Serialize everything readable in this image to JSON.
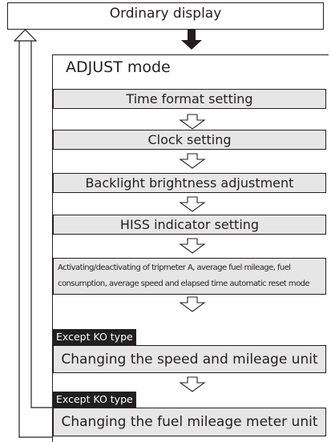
{
  "top": {
    "label": "Ordinary display"
  },
  "panel": {
    "title": "ADJUST mode"
  },
  "steps": [
    {
      "label": "Time format setting"
    },
    {
      "label": "Clock setting"
    },
    {
      "label": "Backlight brightness adjustment"
    },
    {
      "label": "HISS indicator setting"
    },
    {
      "label": "Activating/deactivating of tripmeter A, average fuel mileage, fuel consumption, average speed and elapsed time automatic reset mode"
    },
    {
      "tag": "Except KO type",
      "label": "Changing the speed and mileage unit"
    },
    {
      "tag": "Except KO type",
      "label": "Changing the fuel mileage meter unit"
    }
  ],
  "colors": {
    "line": "#231f20",
    "step_fill": "#e6e6e6",
    "tag_fill": "#231f20",
    "tag_text": "#ffffff"
  }
}
